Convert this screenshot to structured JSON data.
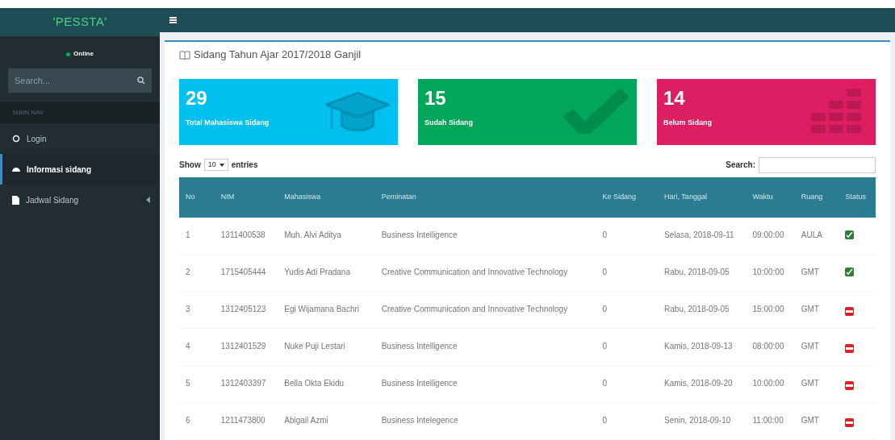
{
  "logo": "'PESSTA'",
  "sidebar": {
    "user_status": "Online",
    "search": {
      "placeholder": "Search..."
    },
    "section": "MAIN NAV",
    "items": [
      {
        "label": "Login",
        "selected": false,
        "has_children": false
      },
      {
        "label": "Informasi sidang",
        "selected": true,
        "has_children": false
      },
      {
        "label": "Jadwal Sidang",
        "selected": false,
        "has_children": true
      }
    ]
  },
  "page_title": "Sidang Tahun Ajar 2017/2018 Ganjil",
  "cards": [
    {
      "value": "29",
      "label": "Total Mahasiswa Sidang",
      "color": "#00c0ef"
    },
    {
      "value": "15",
      "label": "Sudah Sidang",
      "color": "#00a65a"
    },
    {
      "value": "14",
      "label": "Belum Sidang",
      "color": "#dd1e62"
    }
  ],
  "table": {
    "show_label": "Show",
    "page_size": "10",
    "entries_label": "entries",
    "search_label": "Search:",
    "columns": [
      "No",
      "NIM",
      "Mahasiswa",
      "Peminatan",
      "Ke Sidang",
      "Hari, Tanggal",
      "Waktu",
      "Ruang",
      "Status"
    ],
    "rows": [
      {
        "cells": [
          "1",
          "1311400538",
          "Muh. Alvi Aditya",
          "Business Intelligence",
          "0",
          "Selasa, 2018-09-11",
          "09:00:00",
          "AULA"
        ],
        "done": true
      },
      {
        "cells": [
          "2",
          "1715405444",
          "Yudis Adi Pradana",
          "Creative Communication and Innovative Technology",
          "0",
          "Rabu, 2018-09-05",
          "10:00:00",
          "GMT"
        ],
        "done": true
      },
      {
        "cells": [
          "3",
          "1312405123",
          "Egi Wijamana Bachri",
          "Creative Communication and Innovative Technology",
          "0",
          "Rabu, 2018-09-05",
          "15:00:00",
          "GMT"
        ],
        "done": false
      },
      {
        "cells": [
          "4",
          "1312401529",
          "Nuke Puji Lestari",
          "Business Intelligence",
          "0",
          "Kamis, 2018-09-13",
          "08:00:00",
          "GMT"
        ],
        "done": false
      },
      {
        "cells": [
          "5",
          "1312403397",
          "Bella Okta Ekidu",
          "Business Intelligence",
          "0",
          "Kamis, 2018-09-20",
          "10:00:00",
          "GMT"
        ],
        "done": false
      },
      {
        "cells": [
          "6",
          "1211473800",
          "Abigail Azmi",
          "Business Intelegence",
          "0",
          "Senin, 2018-09-10",
          "11:00:00",
          "GMT"
        ],
        "done": false
      }
    ]
  }
}
